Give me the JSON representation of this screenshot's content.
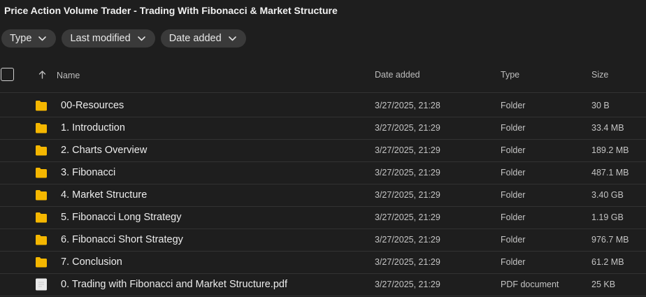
{
  "title": "Price Action Volume Trader - Trading With Fibonacci & Market Structure",
  "filters": [
    {
      "label": "Type"
    },
    {
      "label": "Last modified"
    },
    {
      "label": "Date added"
    }
  ],
  "columns": {
    "name": "Name",
    "date_added": "Date added",
    "type": "Type",
    "size": "Size"
  },
  "colors": {
    "folder": "#f5b700",
    "background": "#1e1e1e",
    "chip": "#3a3a3a"
  },
  "rows": [
    {
      "icon": "folder-icon",
      "name": "00-Resources",
      "date": "3/27/2025, 21:28",
      "type": "Folder",
      "size": "30 B"
    },
    {
      "icon": "folder-icon",
      "name": "1. Introduction",
      "date": "3/27/2025, 21:29",
      "type": "Folder",
      "size": "33.4 MB"
    },
    {
      "icon": "folder-icon",
      "name": "2. Charts Overview",
      "date": "3/27/2025, 21:29",
      "type": "Folder",
      "size": "189.2 MB"
    },
    {
      "icon": "folder-icon",
      "name": "3. Fibonacci",
      "date": "3/27/2025, 21:29",
      "type": "Folder",
      "size": "487.1 MB"
    },
    {
      "icon": "folder-icon",
      "name": "4. Market Structure",
      "date": "3/27/2025, 21:29",
      "type": "Folder",
      "size": "3.40 GB"
    },
    {
      "icon": "folder-icon",
      "name": "5. Fibonacci Long Strategy",
      "date": "3/27/2025, 21:29",
      "type": "Folder",
      "size": "1.19 GB"
    },
    {
      "icon": "folder-icon",
      "name": "6. Fibonacci Short Strategy",
      "date": "3/27/2025, 21:29",
      "type": "Folder",
      "size": "976.7 MB"
    },
    {
      "icon": "folder-icon",
      "name": "7. Conclusion",
      "date": "3/27/2025, 21:29",
      "type": "Folder",
      "size": "61.2 MB"
    },
    {
      "icon": "pdf-file-icon",
      "name": "0. Trading with Fibonacci and Market Structure.pdf",
      "date": "3/27/2025, 21:29",
      "type": "PDF document",
      "size": "25 KB"
    }
  ]
}
